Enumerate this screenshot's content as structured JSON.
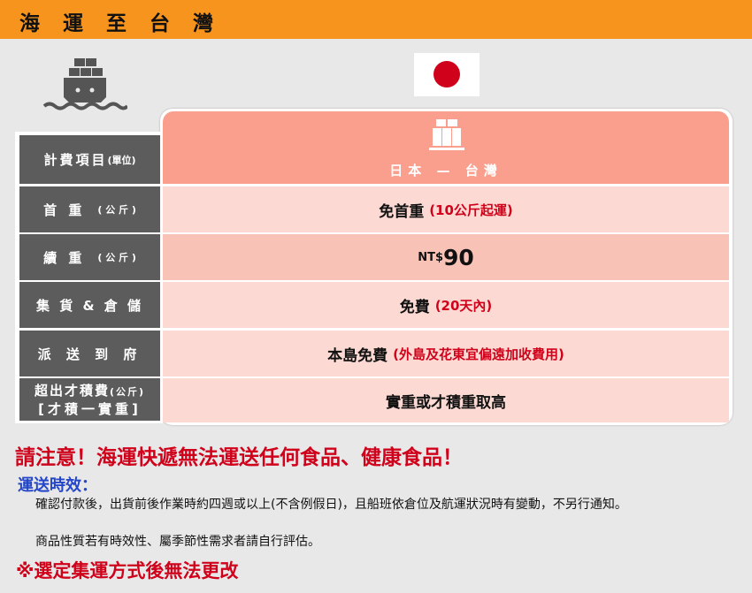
{
  "title": "海 運 至 台 灣",
  "icons": {
    "ship": "cargo-ship-icon",
    "flag": "japan-flag-icon",
    "boxes": "stacked-boxes-icon"
  },
  "colors": {
    "title_bar": "#f7941d",
    "table_header": "#fa9f8e",
    "row_light": "#fcdad3",
    "row_dark": "#f8c2b7",
    "label_cell": "#5c5c5c",
    "warning": "#d0021b",
    "section_title": "#2446c8"
  },
  "table": {
    "route": "日本 — 台灣",
    "header_label": "計費項目",
    "header_unit": "(單位)",
    "rows": [
      {
        "label": "首 重",
        "unit": "( 公 斤 )",
        "value": "免首重",
        "note": "(10公斤起運)"
      },
      {
        "label": "續 重",
        "unit": "( 公 斤 )",
        "currency": "NT$",
        "value": "90"
      },
      {
        "label": "集 貨 & 倉 儲",
        "value": "免費",
        "note": "(20天內)"
      },
      {
        "label": "派 送 到 府",
        "value": "本島免費",
        "note": "(外島及花東宜偏遠加收費用)"
      },
      {
        "label": "超出才積費",
        "label_unit": "(公斤)",
        "label2": "[才積一實重]",
        "value": "實重或才積重取高"
      }
    ]
  },
  "warning": "請注意！海運快遞無法運送任何食品、健康食品！",
  "delivery": {
    "title": "運送時效：",
    "lines": [
      "確認付款後，出貨前後作業時約四週或以上(不含例假日)，且船班依倉位及航運狀況時有變動，不另行通知。",
      "商品性質若有時效性、屬季節性需求者請自行評估。"
    ]
  },
  "final_note": "※選定集運方式後無法更改"
}
